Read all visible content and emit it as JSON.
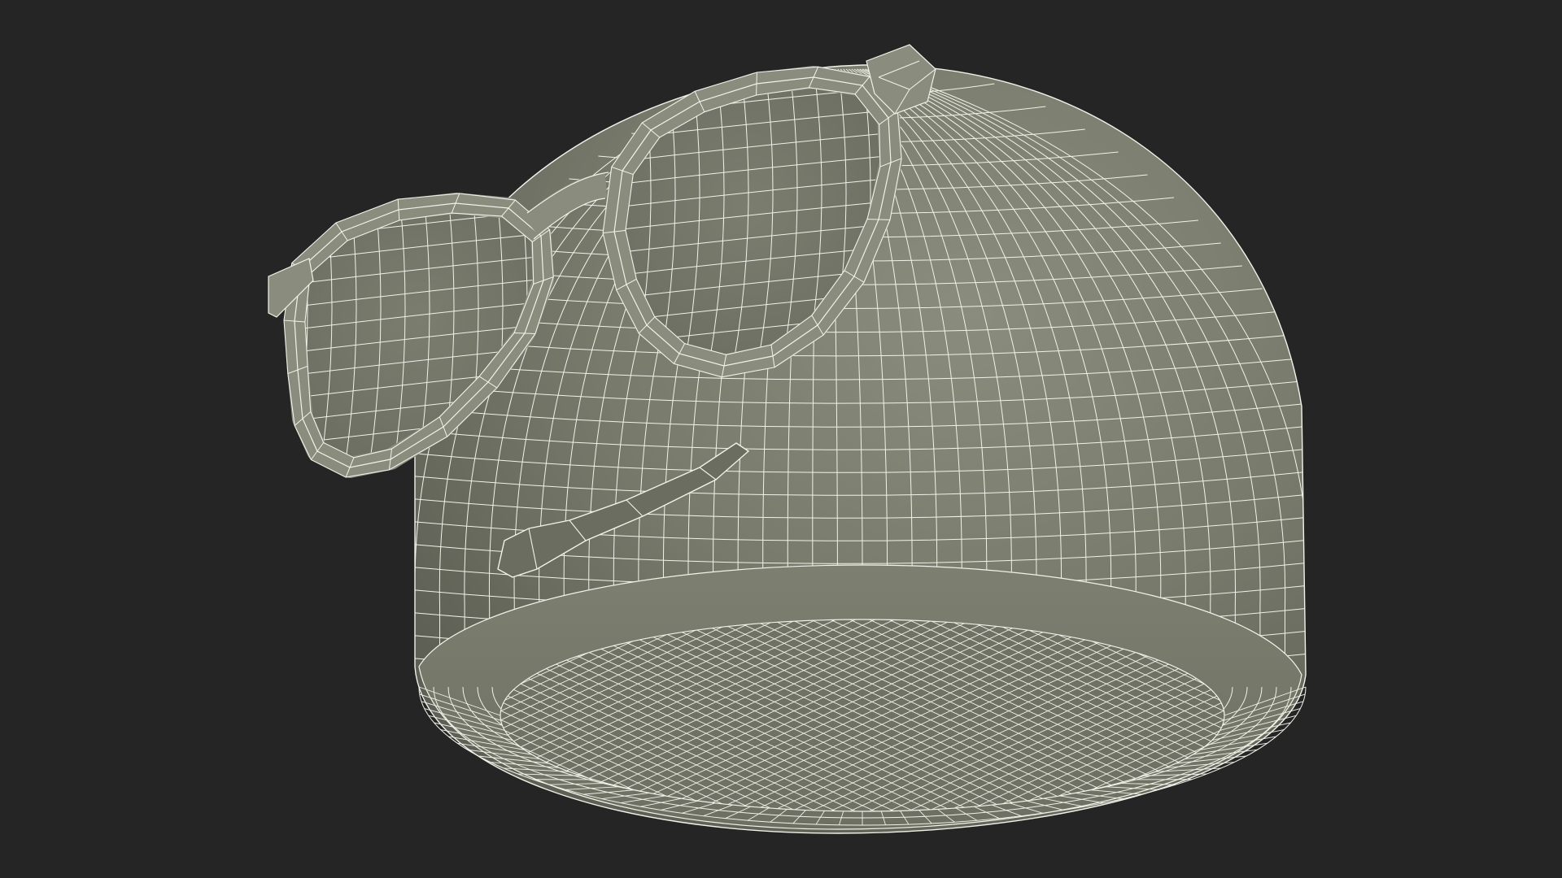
{
  "scene": {
    "background_color": "#252525",
    "surface_color": "#787a6c",
    "surface_shadow_color": "#5e6055",
    "surface_highlight_color": "#8a8c7e",
    "wire_color": "#f2f2ea",
    "objects": [
      "hat",
      "sunglasses"
    ],
    "render_mode": "wireframe-on-shaded"
  }
}
